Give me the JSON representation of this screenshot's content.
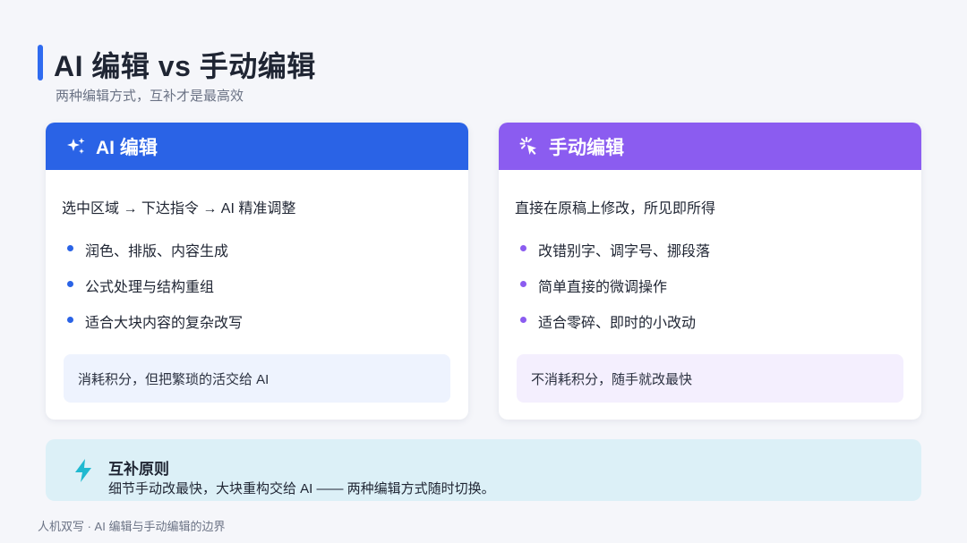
{
  "header": {
    "title": "AI 编辑 vs 手动编辑",
    "subtitle": "两种编辑方式，互补才是最高效"
  },
  "cards": [
    {
      "icon": "sparkles-icon",
      "heading": "AI 编辑",
      "lead": "选中区域 → 下达指令 → AI 精准调整",
      "items": [
        "润色、排版、内容生成",
        "公式处理与结构重组",
        "适合大块内容的复杂改写"
      ],
      "note": "消耗积分，但把繁琐的活交给 AI",
      "accent": "#2a63e6"
    },
    {
      "icon": "pointer-click-icon",
      "heading": "手动编辑",
      "lead": "直接在原稿上修改，所见即所得",
      "items": [
        "改错别字、调字号、挪段落",
        "简单直接的微调操作",
        "适合零碎、即时的小改动"
      ],
      "note": "不消耗积分，随手就改最快",
      "accent": "#8b5cf0"
    }
  ],
  "tip": {
    "icon": "lightning-icon",
    "title": "互补原则",
    "text": "细节手动改最快，大块重构交给 AI —— 两种编辑方式随时切换。",
    "accent": "#1fb9d0"
  },
  "footer": {
    "text": "人机双写 · AI 编辑与手动编辑的边界"
  }
}
